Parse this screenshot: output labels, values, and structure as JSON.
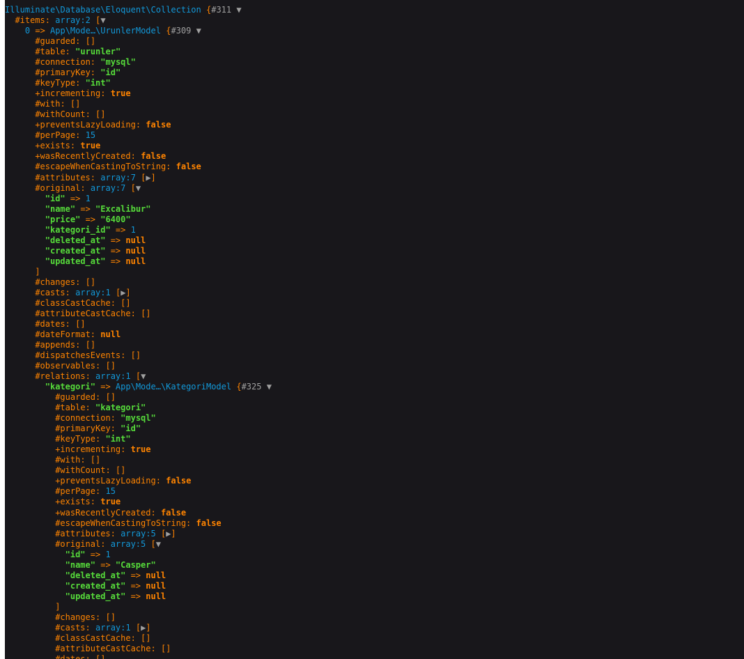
{
  "colors": {
    "background": "#18171b",
    "string": "#56db3a",
    "number": "#1299da",
    "class": "#1299da",
    "keyword": "#ff8400",
    "property": "#ff8400",
    "toggle": "#a0a0a0"
  },
  "dump": {
    "root_class": "Illuminate\\Database\\Eloquent\\Collection",
    "root_ref": "#311",
    "items_key": "#items",
    "items_type": "array:2",
    "item0_index": "0",
    "item0_class": "App\\Mode…\\UrunlerModel",
    "item0_ref": "#309",
    "item0_props": [
      {
        "vis": "#",
        "name": "guarded",
        "kind": "empty",
        "value": "[]"
      },
      {
        "vis": "#",
        "name": "table",
        "kind": "string",
        "value": "\"urunler\""
      },
      {
        "vis": "#",
        "name": "connection",
        "kind": "string",
        "value": "\"mysql\""
      },
      {
        "vis": "#",
        "name": "primaryKey",
        "kind": "string",
        "value": "\"id\""
      },
      {
        "vis": "#",
        "name": "keyType",
        "kind": "string",
        "value": "\"int\""
      },
      {
        "vis": "+",
        "name": "incrementing",
        "kind": "keyword",
        "value": "true"
      },
      {
        "vis": "#",
        "name": "with",
        "kind": "empty",
        "value": "[]"
      },
      {
        "vis": "#",
        "name": "withCount",
        "kind": "empty",
        "value": "[]"
      },
      {
        "vis": "+",
        "name": "preventsLazyLoading",
        "kind": "keyword",
        "value": "false"
      },
      {
        "vis": "#",
        "name": "perPage",
        "kind": "number",
        "value": "15"
      },
      {
        "vis": "+",
        "name": "exists",
        "kind": "keyword",
        "value": "true"
      },
      {
        "vis": "+",
        "name": "wasRecentlyCreated",
        "kind": "keyword",
        "value": "false"
      },
      {
        "vis": "#",
        "name": "escapeWhenCastingToString",
        "kind": "keyword",
        "value": "false"
      }
    ],
    "item0_attributes": {
      "name": "#attributes",
      "type": "array:7"
    },
    "item0_original": {
      "name": "#original",
      "type": "array:7",
      "entries": [
        {
          "key": "\"id\"",
          "kind": "number",
          "value": "1"
        },
        {
          "key": "\"name\"",
          "kind": "string",
          "value": "\"Excalibur\""
        },
        {
          "key": "\"price\"",
          "kind": "string",
          "value": "\"6400\""
        },
        {
          "key": "\"kategori_id\"",
          "kind": "number",
          "value": "1"
        },
        {
          "key": "\"deleted_at\"",
          "kind": "keyword",
          "value": "null"
        },
        {
          "key": "\"created_at\"",
          "kind": "keyword",
          "value": "null"
        },
        {
          "key": "\"updated_at\"",
          "kind": "keyword",
          "value": "null"
        }
      ]
    },
    "item0_props2": [
      {
        "vis": "#",
        "name": "changes",
        "kind": "empty",
        "value": "[]"
      }
    ],
    "item0_casts": {
      "name": "#casts",
      "type": "array:1"
    },
    "item0_props3": [
      {
        "vis": "#",
        "name": "classCastCache",
        "kind": "empty",
        "value": "[]"
      },
      {
        "vis": "#",
        "name": "attributeCastCache",
        "kind": "empty",
        "value": "[]"
      },
      {
        "vis": "#",
        "name": "dates",
        "kind": "empty",
        "value": "[]"
      },
      {
        "vis": "#",
        "name": "dateFormat",
        "kind": "keyword",
        "value": "null"
      },
      {
        "vis": "#",
        "name": "appends",
        "kind": "empty",
        "value": "[]"
      },
      {
        "vis": "#",
        "name": "dispatchesEvents",
        "kind": "empty",
        "value": "[]"
      },
      {
        "vis": "#",
        "name": "observables",
        "kind": "empty",
        "value": "[]"
      }
    ],
    "relations": {
      "name": "#relations",
      "type": "array:1"
    },
    "kategori_key": "\"kategori\"",
    "kategori_class": "App\\Mode…\\KategoriModel",
    "kategori_ref": "#325",
    "kategori_props": [
      {
        "vis": "#",
        "name": "guarded",
        "kind": "empty",
        "value": "[]"
      },
      {
        "vis": "#",
        "name": "table",
        "kind": "string",
        "value": "\"kategori\""
      },
      {
        "vis": "#",
        "name": "connection",
        "kind": "string",
        "value": "\"mysql\""
      },
      {
        "vis": "#",
        "name": "primaryKey",
        "kind": "string",
        "value": "\"id\""
      },
      {
        "vis": "#",
        "name": "keyType",
        "kind": "string",
        "value": "\"int\""
      },
      {
        "vis": "+",
        "name": "incrementing",
        "kind": "keyword",
        "value": "true"
      },
      {
        "vis": "#",
        "name": "with",
        "kind": "empty",
        "value": "[]"
      },
      {
        "vis": "#",
        "name": "withCount",
        "kind": "empty",
        "value": "[]"
      },
      {
        "vis": "+",
        "name": "preventsLazyLoading",
        "kind": "keyword",
        "value": "false"
      },
      {
        "vis": "#",
        "name": "perPage",
        "kind": "number",
        "value": "15"
      },
      {
        "vis": "+",
        "name": "exists",
        "kind": "keyword",
        "value": "true"
      },
      {
        "vis": "+",
        "name": "wasRecentlyCreated",
        "kind": "keyword",
        "value": "false"
      },
      {
        "vis": "#",
        "name": "escapeWhenCastingToString",
        "kind": "keyword",
        "value": "false"
      }
    ],
    "kategori_attributes": {
      "name": "#attributes",
      "type": "array:5"
    },
    "kategori_original": {
      "name": "#original",
      "type": "array:5",
      "entries": [
        {
          "key": "\"id\"",
          "kind": "number",
          "value": "1"
        },
        {
          "key": "\"name\"",
          "kind": "string",
          "value": "\"Casper\""
        },
        {
          "key": "\"deleted_at\"",
          "kind": "keyword",
          "value": "null"
        },
        {
          "key": "\"created_at\"",
          "kind": "keyword",
          "value": "null"
        },
        {
          "key": "\"updated_at\"",
          "kind": "keyword",
          "value": "null"
        }
      ]
    },
    "kategori_props2": [
      {
        "vis": "#",
        "name": "changes",
        "kind": "empty",
        "value": "[]"
      }
    ],
    "kategori_casts": {
      "name": "#casts",
      "type": "array:1"
    },
    "kategori_props3": [
      {
        "vis": "#",
        "name": "classCastCache",
        "kind": "empty",
        "value": "[]"
      },
      {
        "vis": "#",
        "name": "attributeCastCache",
        "kind": "empty",
        "value": "[]"
      },
      {
        "vis": "#",
        "name": "dates",
        "kind": "empty",
        "value": "[]"
      }
    ],
    "symbols": {
      "open_brace": "{",
      "open_bracket": "[",
      "close_bracket": "]",
      "arrow": "=>",
      "colon": ":",
      "expanded": "▼",
      "collapsed": "▶"
    }
  }
}
